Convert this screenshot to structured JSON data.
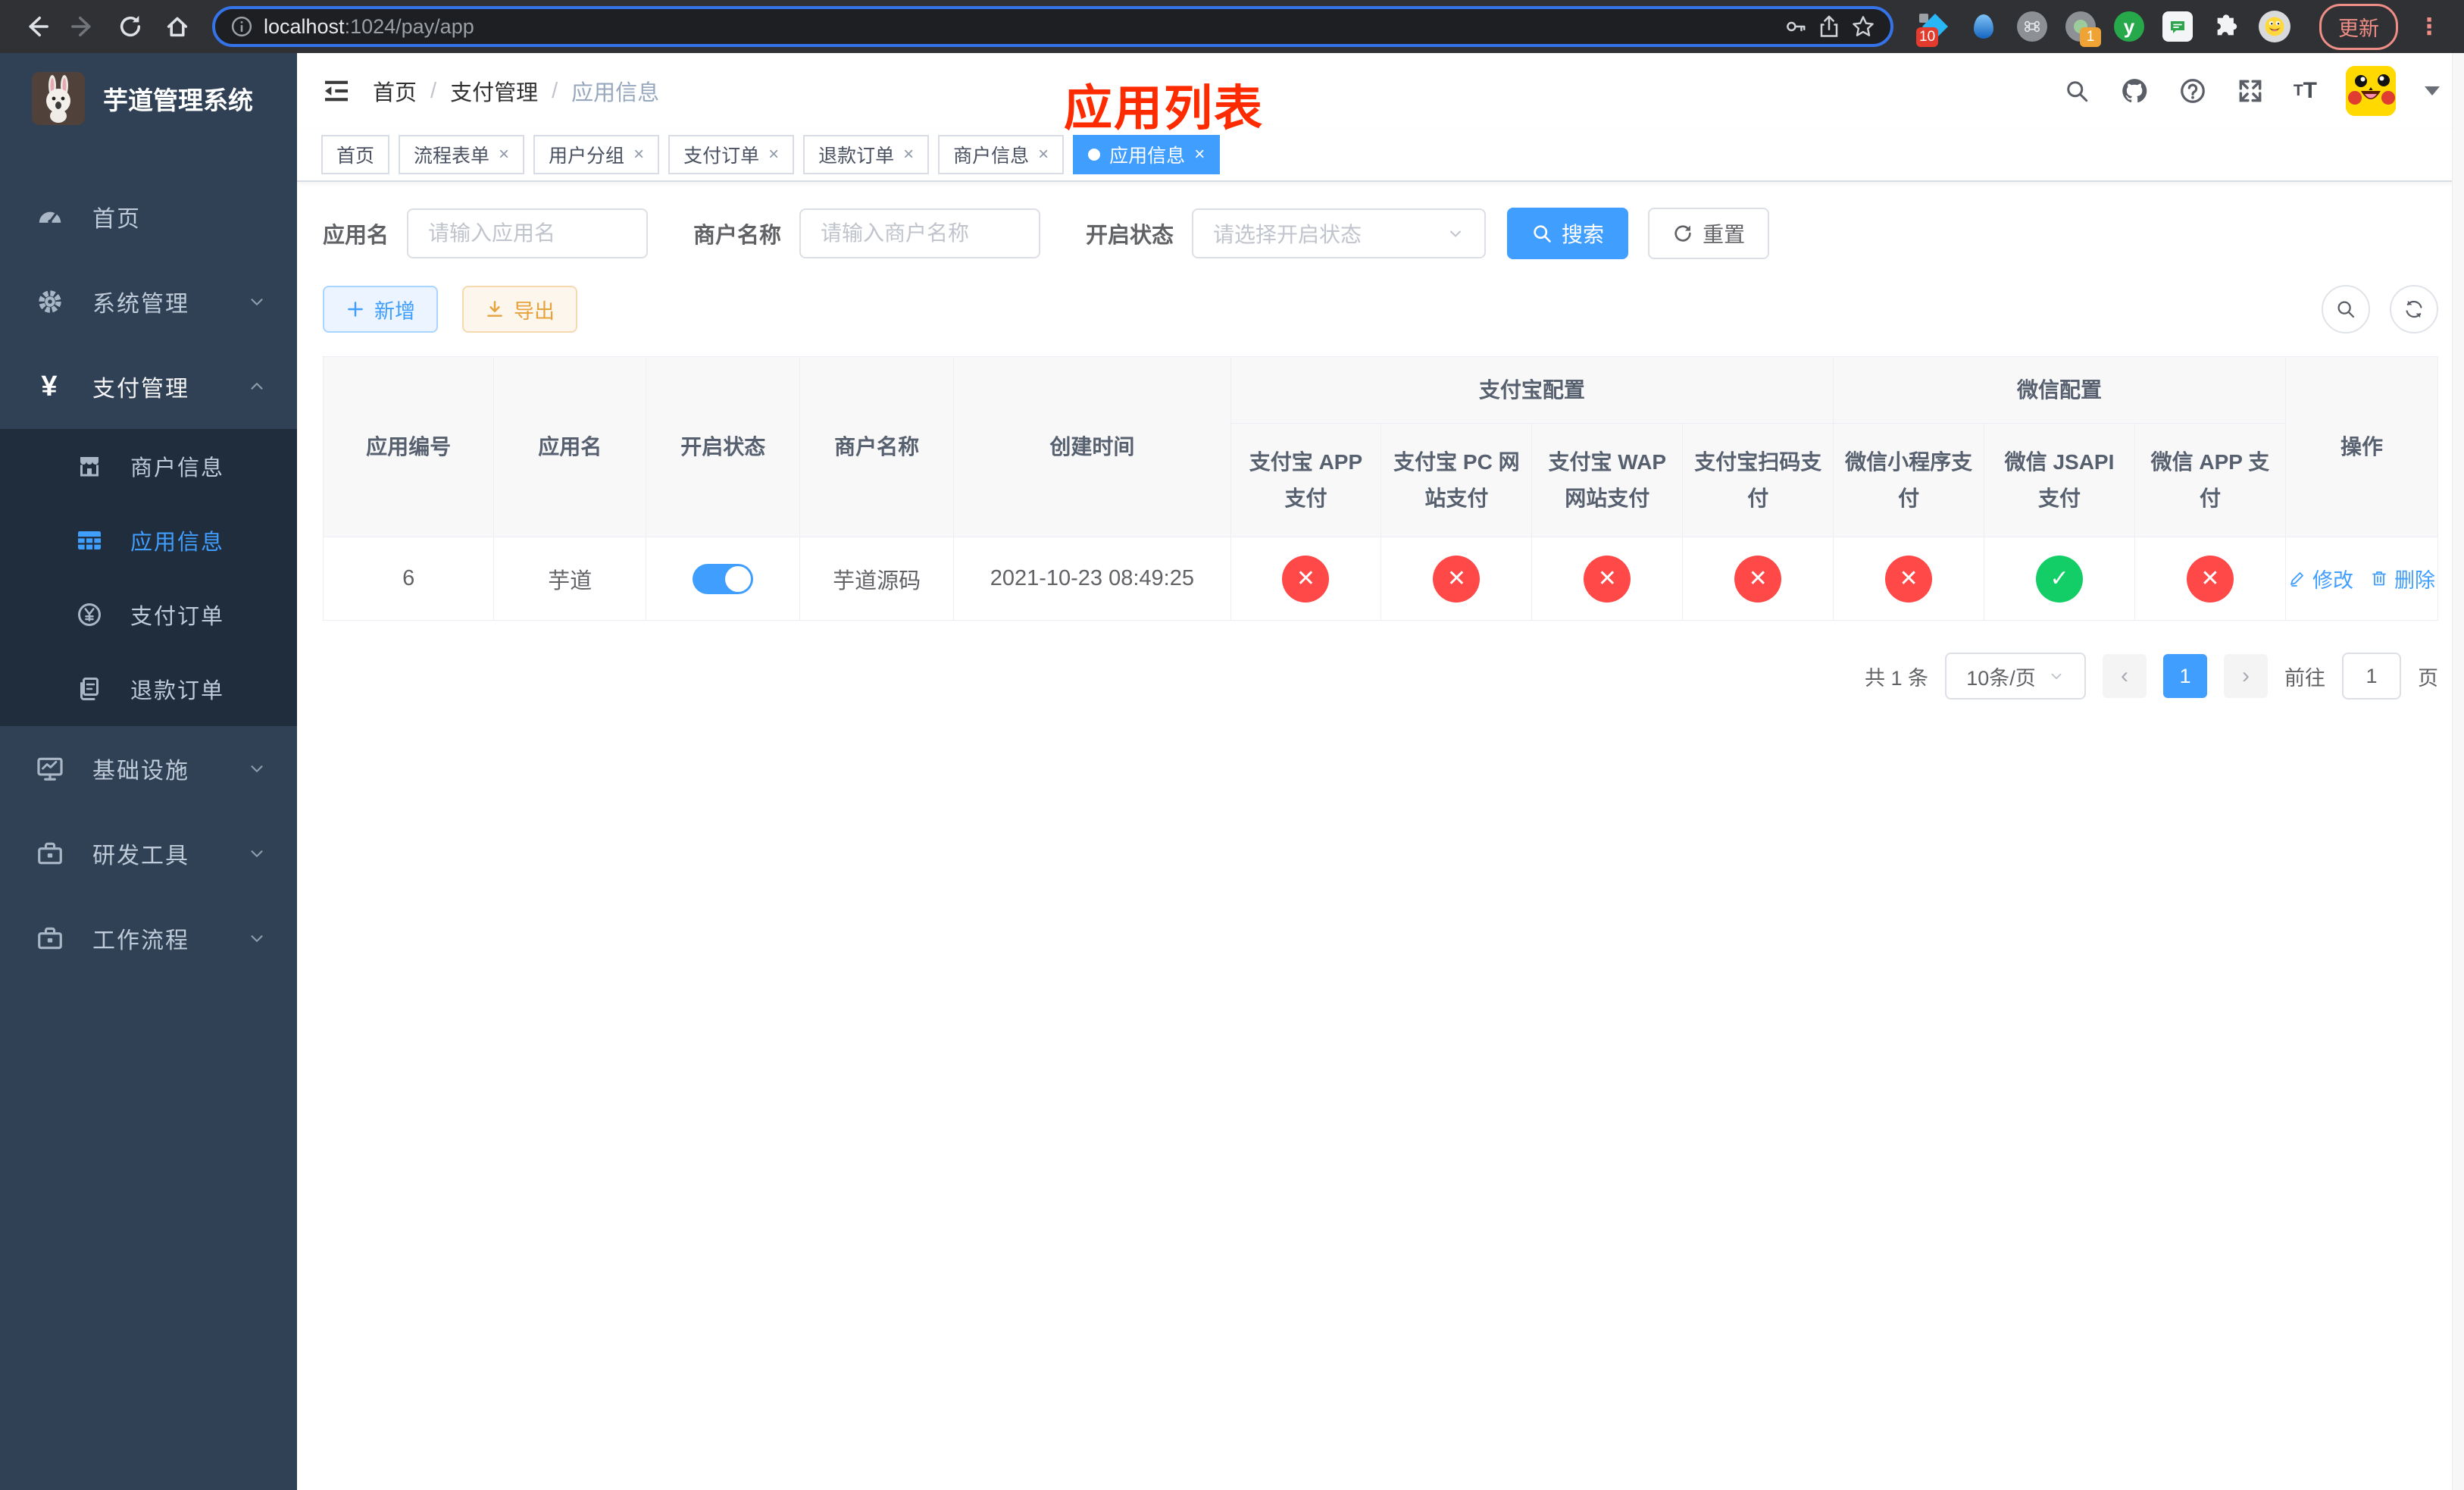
{
  "browser": {
    "url_host": "localhost",
    "url_rest": ":1024/pay/app",
    "update_label": "更新",
    "ext_badge_blue_diamond": "10",
    "ext_badge_session": "1",
    "ext_y_letter": "y"
  },
  "sidebar": {
    "title": "芋道管理系统",
    "items": [
      {
        "label": "首页"
      },
      {
        "label": "系统管理"
      },
      {
        "label": "支付管理"
      },
      {
        "label": "基础设施"
      },
      {
        "label": "研发工具"
      },
      {
        "label": "工作流程"
      }
    ],
    "subitems": [
      {
        "label": "商户信息"
      },
      {
        "label": "应用信息"
      },
      {
        "label": "支付订单"
      },
      {
        "label": "退款订单"
      }
    ]
  },
  "header": {
    "breadcrumb": [
      {
        "label": "首页"
      },
      {
        "label": "支付管理"
      },
      {
        "label": "应用信息"
      }
    ],
    "annotation": "应用列表"
  },
  "tabs": [
    {
      "label": "首页"
    },
    {
      "label": "流程表单"
    },
    {
      "label": "用户分组"
    },
    {
      "label": "支付订单"
    },
    {
      "label": "退款订单"
    },
    {
      "label": "商户信息"
    },
    {
      "label": "应用信息"
    }
  ],
  "filters": {
    "app_name_label": "应用名",
    "app_name_placeholder": "请输入应用名",
    "merchant_label": "商户名称",
    "merchant_placeholder": "请输入商户名称",
    "status_label": "开启状态",
    "status_placeholder": "请选择开启状态",
    "search_label": "搜索",
    "reset_label": "重置"
  },
  "toolbar": {
    "add_label": "新增",
    "export_label": "导出"
  },
  "table": {
    "columns": {
      "app_id": "应用编号",
      "app_name": "应用名",
      "status": "开启状态",
      "merchant": "商户名称",
      "created": "创建时间",
      "alipay_group": "支付宝配置",
      "wechat_group": "微信配置",
      "alipay_app": "支付宝 APP 支付",
      "alipay_pc": "支付宝 PC 网站支付",
      "alipay_wap": "支付宝 WAP 网站支付",
      "alipay_qr": "支付宝扫码支付",
      "wx_lite": "微信小程序支付",
      "wx_jsapi": "微信 JSAPI 支付",
      "wx_app": "微信 APP 支付",
      "ops": "操作"
    },
    "row": {
      "id": "6",
      "name": "芋道",
      "enabled": true,
      "merchant": "芋道源码",
      "created": "2021-10-23 08:49:25",
      "channels": [
        false,
        false,
        false,
        false,
        false,
        true,
        false
      ]
    },
    "actions": {
      "edit": "修改",
      "delete": "删除"
    }
  },
  "icons": {
    "enabled_glyph": "✓",
    "disabled_glyph": "✕"
  },
  "pagination": {
    "total": "共 1 条",
    "page_size": "10条/页",
    "page": "1",
    "goto_label": "前往",
    "goto_value": "1",
    "page_unit": "页"
  },
  "colors": {
    "primary": "#409eff",
    "danger": "#ff4949",
    "success": "#13ce66",
    "annotation_red": "#fe2b00",
    "sidebar_bg": "#304156",
    "submenu_bg": "#1f2d3d"
  }
}
